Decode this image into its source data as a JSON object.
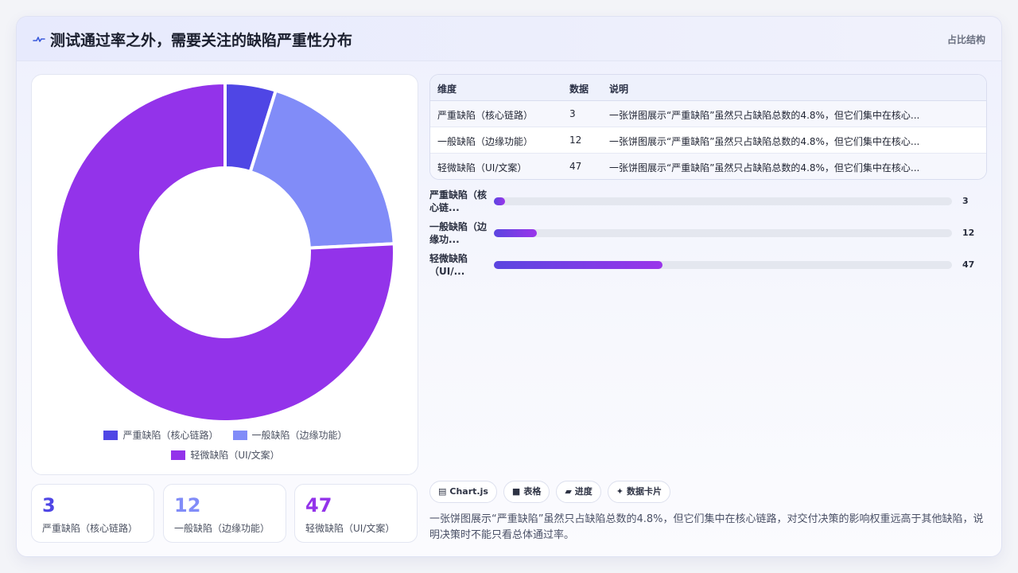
{
  "header": {
    "title": "测试通过率之外，需要关注的缺陷严重性分布",
    "tag": "占比结构"
  },
  "colors": {
    "severe": "#4f46e5",
    "general": "#818cf8",
    "minor": "#9333ea"
  },
  "chart_data": {
    "type": "pie",
    "categories": [
      "严重缺陷（核心链路）",
      "一般缺陷（边缘功能）",
      "轻微缺陷（UI/文案）"
    ],
    "values": [
      3,
      12,
      47
    ],
    "title": "",
    "legend": "bottom"
  },
  "table": {
    "headers": [
      "维度",
      "数据",
      "说明"
    ],
    "rows": [
      [
        "严重缺陷（核心链路）",
        "3",
        "一张饼图展示“严重缺陷”虽然只占缺陷总数的4.8%，但它们集中在核心..."
      ],
      [
        "一般缺陷（边缘功能）",
        "12",
        "一张饼图展示“严重缺陷”虽然只占缺陷总数的4.8%，但它们集中在核心..."
      ],
      [
        "轻微缺陷（UI/文案）",
        "47",
        "一张饼图展示“严重缺陷”虽然只占缺陷总数的4.8%，但它们集中在核心..."
      ]
    ]
  },
  "progress": {
    "max": 128,
    "rows": [
      {
        "label": "严重缺陷（核心链...",
        "value": 3
      },
      {
        "label": "一般缺陷（边缘功...",
        "value": 12
      },
      {
        "label": "轻微缺陷（UI/...",
        "value": 47
      }
    ]
  },
  "kpis": [
    {
      "value": "3",
      "label": "严重缺陷（核心链路）",
      "color": "#4f46e5"
    },
    {
      "value": "12",
      "label": "一般缺陷（边缘功能）",
      "color": "#818cf8"
    },
    {
      "value": "47",
      "label": "轻微缺陷（UI/文案）",
      "color": "#9333ea"
    }
  ],
  "chips": [
    {
      "icon": "▤",
      "label": "Chart.js"
    },
    {
      "icon": "■",
      "label": "表格"
    },
    {
      "icon": "▰",
      "label": "进度"
    },
    {
      "icon": "✦",
      "label": "数据卡片"
    }
  ],
  "description": "一张饼图展示“严重缺陷”虽然只占缺陷总数的4.8%，但它们集中在核心链路，对交付决策的影响权重远高于其他缺陷，说明决策时不能只看总体通过率。"
}
